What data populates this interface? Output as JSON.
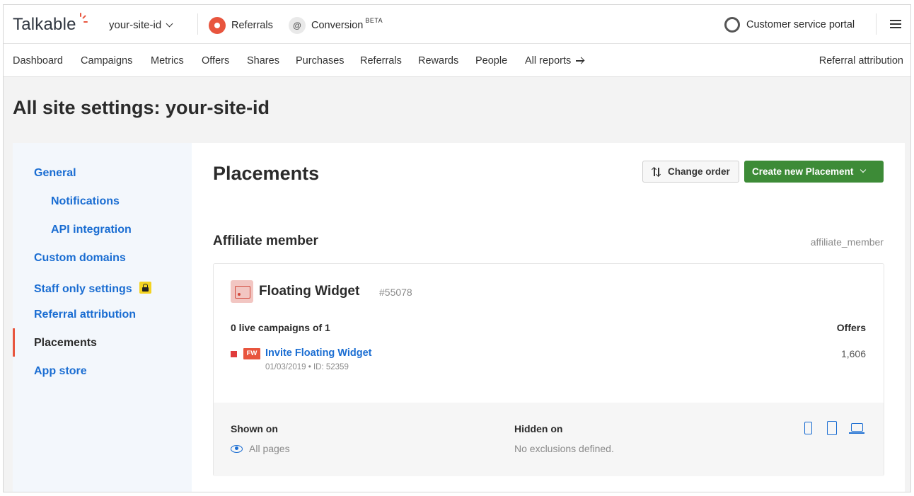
{
  "header": {
    "logo": "Talkable",
    "site_id": "your-site-id",
    "products": [
      {
        "label": "Referrals",
        "icon": "referrals-icon"
      },
      {
        "label": "Conversion",
        "badge": "BETA",
        "icon": "conversion-at-icon"
      }
    ],
    "portal": "Customer service portal"
  },
  "nav": {
    "items": [
      "Dashboard",
      "Campaigns",
      "Metrics",
      "Offers",
      "Shares",
      "Purchases",
      "Referrals",
      "Rewards",
      "People",
      "All reports"
    ],
    "right": "Referral attribution"
  },
  "page": {
    "title": "All site settings: your-site-id"
  },
  "sidebar": {
    "items": [
      {
        "label": "General"
      },
      {
        "label": "Notifications"
      },
      {
        "label": "API integration"
      },
      {
        "label": "Custom domains"
      },
      {
        "label": "Staff only settings"
      },
      {
        "label": "Referral attribution"
      },
      {
        "label": "Placements",
        "active": true
      },
      {
        "label": "App store"
      }
    ]
  },
  "main": {
    "title": "Placements",
    "change_order": "Change order",
    "create_new": "Create new Placement",
    "section": {
      "title": "Affiliate member",
      "key": "affiliate_member"
    },
    "card": {
      "title": "Floating Widget",
      "id": "#55078",
      "live": "0 live campaigns of 1",
      "offers_header": "Offers",
      "campaign": {
        "badge": "FW",
        "name": "Invite Floating Widget",
        "meta": "01/03/2019 • ID: 52359",
        "offers": "1,606"
      },
      "shown_on_label": "Shown on",
      "shown_on_value": "All pages",
      "hidden_on_label": "Hidden on",
      "hidden_on_value": "No exclusions defined."
    }
  },
  "colors": {
    "accent": "#1a6dd2",
    "brand": "#e8553e",
    "primary_button": "#3d8b37"
  }
}
